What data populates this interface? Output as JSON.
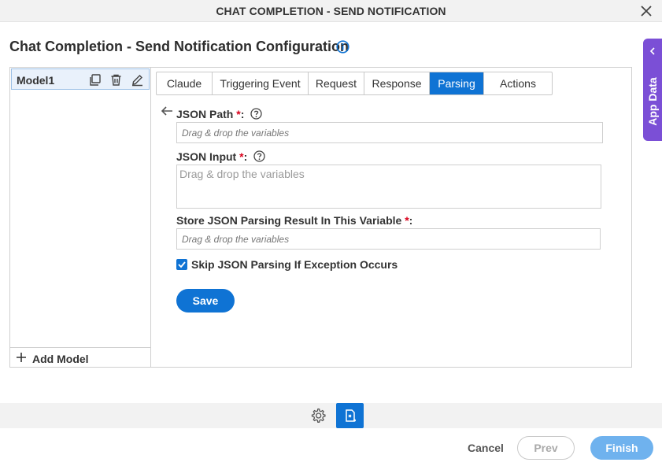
{
  "window": {
    "title": "CHAT COMPLETION - SEND NOTIFICATION"
  },
  "page": {
    "title": "Chat Completion - Send Notification Configuration"
  },
  "side_panel": {
    "label": "App Data"
  },
  "models": {
    "items": [
      {
        "name": "Model1"
      }
    ],
    "add_label": "Add Model"
  },
  "tabs": [
    {
      "label": "Claude",
      "active": false
    },
    {
      "label": "Triggering Event",
      "active": false
    },
    {
      "label": "Request",
      "active": false
    },
    {
      "label": "Response",
      "active": false
    },
    {
      "label": "Parsing",
      "active": true
    },
    {
      "label": "Actions",
      "active": false
    }
  ],
  "form": {
    "json_path": {
      "label": "JSON Path",
      "required": "*",
      "suffix": ":",
      "placeholder": "Drag & drop the variables",
      "value": ""
    },
    "json_input": {
      "label": "JSON Input",
      "required": "*",
      "suffix": ":",
      "placeholder": "Drag & drop the variables",
      "value": ""
    },
    "store_result": {
      "label": "Store JSON Parsing Result In This Variable",
      "required": "*",
      "suffix": ":",
      "placeholder": "Drag & drop the variables",
      "value": ""
    },
    "skip_exception": {
      "label": "Skip JSON Parsing If Exception Occurs",
      "checked": true
    },
    "save_label": "Save"
  },
  "footer": {
    "cancel_label": "Cancel",
    "prev_label": "Prev",
    "finish_label": "Finish"
  },
  "colors": {
    "accent": "#0f73d4",
    "app_data": "#7b4fd6",
    "required": "#d9001b",
    "finish_disabled": "#6fb2ee"
  },
  "icons": [
    "close-icon",
    "info-icon",
    "chevron-left-icon",
    "copy-icon",
    "trash-icon",
    "edit-icon",
    "plus-icon",
    "back-arrow-icon",
    "help-icon",
    "check-icon",
    "gear-icon",
    "document-icon"
  ]
}
